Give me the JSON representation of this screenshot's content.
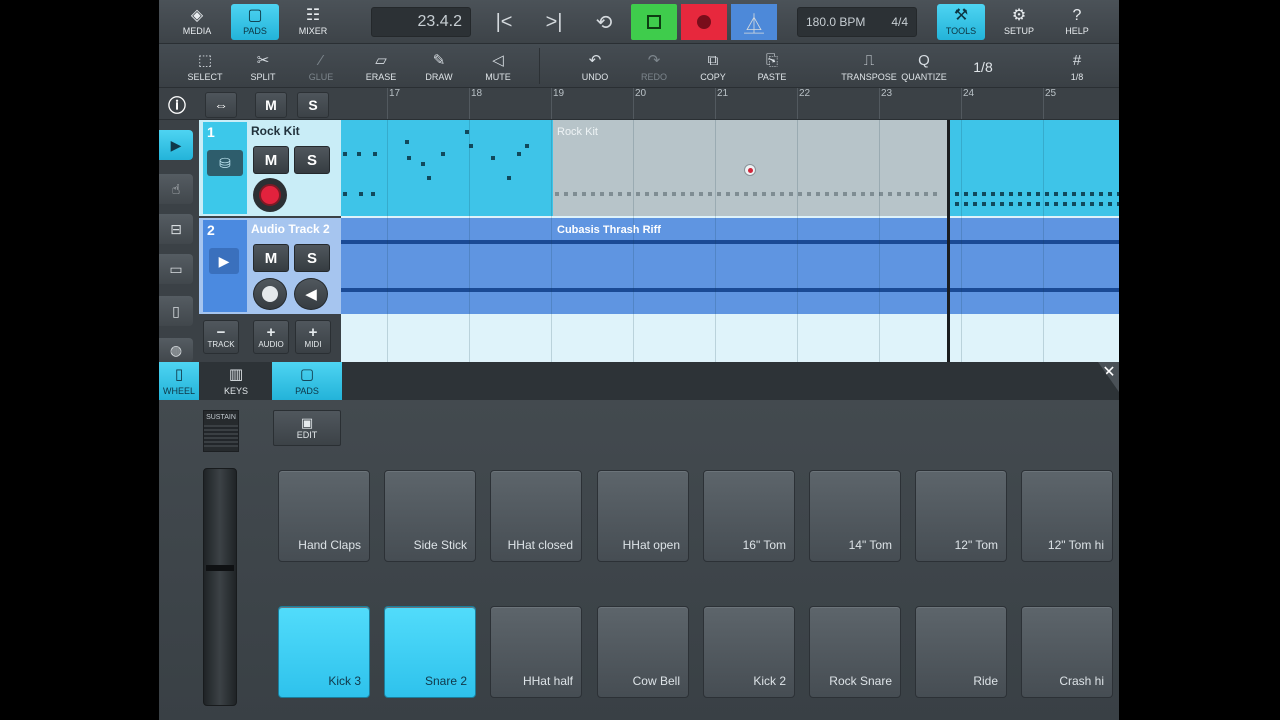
{
  "colors": {
    "accent": "#36c5ea",
    "record": "#e2223d",
    "stop": "#3fcc4c",
    "metronome": "#4d89d9",
    "track1": "#3ec4e8",
    "track2": "#5f95e1"
  },
  "topbar": {
    "media": "MEDIA",
    "pads": "PADS",
    "mixer": "MIXER",
    "position": "23.4.2",
    "tempo": "180.0 BPM",
    "signature": "4/4",
    "tools": "TOOLS",
    "setup": "SETUP",
    "help": "HELP"
  },
  "toolsbar": {
    "select": "SELECT",
    "split": "SPLIT",
    "glue": "GLUE",
    "erase": "ERASE",
    "draw": "DRAW",
    "mute": "MUTE",
    "undo": "UNDO",
    "redo": "REDO",
    "copy": "COPY",
    "paste": "PASTE",
    "transpose": "TRANSPOSE",
    "quantize": "QUANTIZE",
    "quantize_value": "1/8",
    "grid": "1/8"
  },
  "ruler": {
    "m_label": "M",
    "s_label": "S",
    "bars": [
      "17",
      "18",
      "19",
      "20",
      "21",
      "22",
      "23",
      "24",
      "25"
    ]
  },
  "tracks": [
    {
      "number": "1",
      "name": "Rock Kit",
      "m": "M",
      "s": "S",
      "region": "Rock Kit"
    },
    {
      "number": "2",
      "name": "Audio Track 2",
      "m": "M",
      "s": "S",
      "region": "Cubasis Thrash Riff"
    }
  ],
  "addrow": {
    "track": "TRACK",
    "audio": "AUDIO",
    "midi": "MIDI"
  },
  "panel_tabs": {
    "wheel": "WHEEL",
    "keys": "KEYS",
    "pads": "PADS"
  },
  "panel": {
    "sustain": "SUSTAIN",
    "edit": "EDIT"
  },
  "pads": [
    {
      "label": "Hand Claps",
      "lit": false
    },
    {
      "label": "Side Stick",
      "lit": false
    },
    {
      "label": "HHat closed",
      "lit": false
    },
    {
      "label": "HHat open",
      "lit": false
    },
    {
      "label": "16\" Tom",
      "lit": false
    },
    {
      "label": "14\" Tom",
      "lit": false
    },
    {
      "label": "12\" Tom",
      "lit": false
    },
    {
      "label": "12\" Tom hi",
      "lit": false
    },
    {
      "label": "Kick 3",
      "lit": true
    },
    {
      "label": "Snare 2",
      "lit": true
    },
    {
      "label": "HHat half",
      "lit": false
    },
    {
      "label": "Cow Bell",
      "lit": false
    },
    {
      "label": "Kick 2",
      "lit": false
    },
    {
      "label": "Rock Snare",
      "lit": false
    },
    {
      "label": "Ride",
      "lit": false
    },
    {
      "label": "Crash hi",
      "lit": false
    }
  ]
}
